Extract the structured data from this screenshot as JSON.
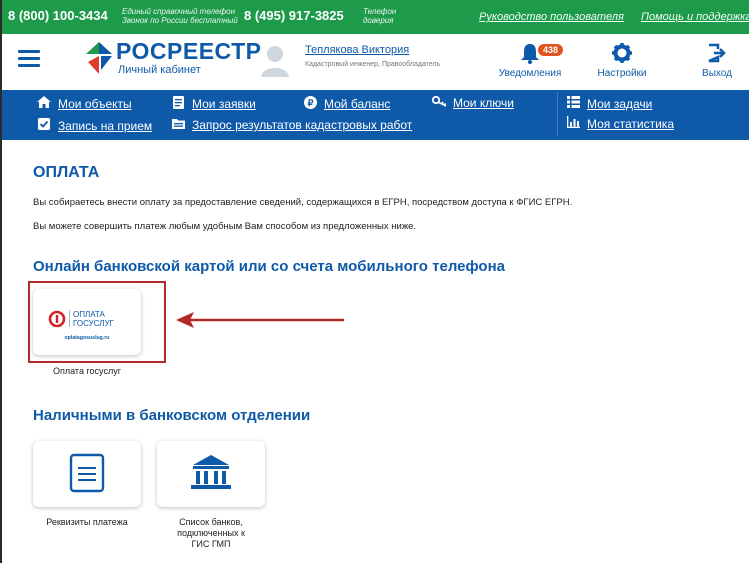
{
  "topbar": {
    "phone1": "8 (800) 100-3434",
    "phone1_note_line1": "Единый справочный телефон",
    "phone1_note_line2": "Звонок по России бесплатный",
    "phone2": "8 (495) 917-3825",
    "phone2_note_line1": "Телефон",
    "phone2_note_line2": "доверия",
    "guide_link": "Руководство пользователя",
    "help_link": "Помощь и поддержка"
  },
  "header": {
    "logo_title": "РОСРЕЕСТР",
    "logo_subtitle": "Личный кабинет",
    "user_name": "Теплякова Виктория",
    "user_role": "Кадастровый инженер, Правообладатель",
    "notifications_label": "Уведомления",
    "notifications_count": "438",
    "settings_label": "Настройки",
    "logout_label": "Выход"
  },
  "nav": {
    "items": [
      {
        "label": "Мои объекты",
        "icon": "home-icon"
      },
      {
        "label": "Мои заявки",
        "icon": "document-icon"
      },
      {
        "label": "Мой баланс",
        "icon": "balance-icon"
      },
      {
        "label": "Мои ключи",
        "icon": "key-icon"
      },
      {
        "label": "Мои задачи",
        "icon": "tasks-icon"
      },
      {
        "label": "Запись на прием",
        "icon": "checkbox-icon"
      },
      {
        "label": "Запрос результатов кадастровых работ",
        "icon": "folder-icon"
      },
      {
        "label": "Моя статистика",
        "icon": "chart-icon"
      }
    ]
  },
  "content": {
    "title": "ОПЛАТА",
    "para1": "Вы собираетесь внести оплату за предоставление сведений, содержащихся в ЕГРН, посредством доступа к ФГИС ЕГРН.",
    "para2": "Вы можете совершить платеж любым удобным Вам способом из предложенных ниже.",
    "online_section_title": "Онлайн банковской картой или со счета мобильного телефона",
    "cash_section_title": "Наличными в банковском отделении",
    "oplata_logo_line1": "ОПЛАТА",
    "oplata_logo_line2": "ГОСУСЛУГ",
    "oplata_logo_url": "oplatagosuslug.ru",
    "oplata_card_label": "Оплата госуслуг",
    "requisites_label": "Реквизиты платежа",
    "banks_label_line1": "Список банков,",
    "banks_label_line2": "подключенных к",
    "banks_label_line3": "ГИС ГМП"
  },
  "colors": {
    "topbar_green": "#1e9a4b",
    "brand_blue": "#0f5aa8",
    "highlight_red": "#b02a2a",
    "badge_orange": "#e2541f"
  }
}
